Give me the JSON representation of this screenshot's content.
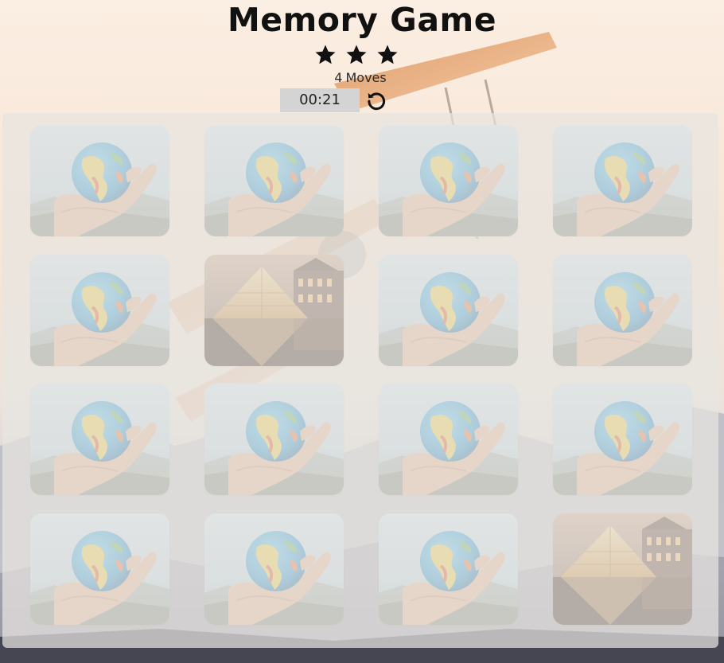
{
  "game": {
    "title": "Memory Game",
    "stars_filled": 3,
    "moves_count": "4",
    "moves_label": "Moves",
    "timer": "00:21"
  },
  "icons": {
    "star": "star-icon",
    "restart": "restart-icon"
  },
  "colors": {
    "deck_bg": "#e8e5e1",
    "timer_bg": "#d4d4d4",
    "text": "#111111"
  },
  "deck": {
    "rows": 4,
    "cols": 4,
    "cards": [
      {
        "state": "hidden",
        "image": "globe-in-hand"
      },
      {
        "state": "hidden",
        "image": "globe-in-hand"
      },
      {
        "state": "hidden",
        "image": "globe-in-hand"
      },
      {
        "state": "hidden",
        "image": "globe-in-hand"
      },
      {
        "state": "hidden",
        "image": "globe-in-hand"
      },
      {
        "state": "open",
        "image": "louvre-pyramid"
      },
      {
        "state": "hidden",
        "image": "globe-in-hand"
      },
      {
        "state": "hidden",
        "image": "globe-in-hand"
      },
      {
        "state": "hidden",
        "image": "globe-in-hand"
      },
      {
        "state": "hidden",
        "image": "globe-in-hand"
      },
      {
        "state": "hidden",
        "image": "globe-in-hand"
      },
      {
        "state": "hidden",
        "image": "globe-in-hand"
      },
      {
        "state": "hidden",
        "image": "globe-in-hand"
      },
      {
        "state": "hidden",
        "image": "globe-in-hand"
      },
      {
        "state": "hidden",
        "image": "globe-in-hand"
      },
      {
        "state": "open",
        "image": "louvre-pyramid"
      }
    ]
  }
}
